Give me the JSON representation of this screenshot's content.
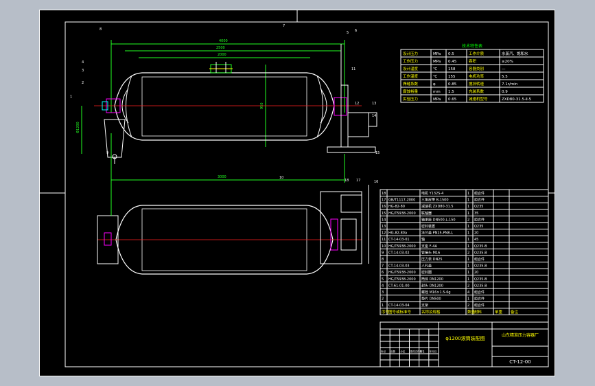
{
  "spec_table": {
    "title": "技术特性表",
    "rows": [
      [
        "设计压力",
        "MPa",
        "0.5",
        "工作介质",
        "水蒸汽、饱和水"
      ],
      [
        "工作压力",
        "MPa",
        "0.45",
        "容积",
        "≥20%"
      ],
      [
        "设计温度",
        "℃",
        "158",
        "容器类别",
        "—"
      ],
      [
        "工作温度",
        "℃",
        "155",
        "电机功率",
        "5.5"
      ],
      [
        "焊缝系数",
        "φ",
        "0.85",
        "搅拌转速",
        "7.1r/min"
      ],
      [
        "腐蚀裕量",
        "mm",
        "1.5",
        "充装系数",
        "0.9"
      ],
      [
        "实验压力",
        "MPa",
        "0.65",
        "减速机型号",
        "ZXD80-31.5-Ⅱ-5"
      ]
    ]
  },
  "parts_list": [
    [
      "18",
      "",
      "电机 Y132S-4",
      "1",
      "组合件",
      "",
      ""
    ],
    [
      "17",
      "GB/T1117-2000",
      "三角皮带 B-1500",
      "1",
      "组合件",
      "",
      ""
    ],
    [
      "16",
      "HG-82-80",
      "减速机 ZXD80-31.5",
      "1",
      "Q235",
      "",
      ""
    ],
    [
      "15",
      "HG/T5938-2000",
      "联轴器",
      "1",
      "35",
      "",
      ""
    ],
    [
      "14",
      "",
      "轴承座 DN500-L-150",
      "2",
      "组合件",
      "",
      ""
    ],
    [
      "13",
      "",
      "密封装置",
      "1",
      "Q235",
      "",
      ""
    ],
    [
      "12",
      "HG-82-80a",
      "法兰盖 PN25-PN8-L",
      "1",
      "20",
      "",
      ""
    ],
    [
      "11",
      "CT-14-03-01",
      "轴",
      "1",
      "45",
      "",
      ""
    ],
    [
      "10",
      "HG/T5938-2000",
      "支座 F-4A",
      "1",
      "Q235-B",
      "",
      ""
    ],
    [
      "9",
      "CT-14-03-02",
      "管接头 M16",
      "2",
      "Q235-B",
      "",
      ""
    ],
    [
      "8",
      "",
      "压力表 DN25",
      "1",
      "组合件",
      "",
      ""
    ],
    [
      "7",
      "CT-14-03-03",
      "人孔盖",
      "1",
      "Q235-B",
      "",
      ""
    ],
    [
      "6",
      "HG/T5938-2000",
      "密封圈",
      "1",
      "20",
      "",
      ""
    ],
    [
      "5",
      "HG/T5938-2000",
      "筒体 DN1200",
      "1",
      "Q235-B",
      "",
      ""
    ],
    [
      "4",
      "CT-61-01-00",
      "封头 DN1200",
      "2",
      "Q235-B",
      "",
      ""
    ],
    [
      "3",
      "",
      "螺栓 M16×1.5-6g",
      "4",
      "组合件",
      "",
      ""
    ],
    [
      "2",
      "",
      "垫片 DN500",
      "1",
      "组合件",
      "",
      ""
    ],
    [
      "1",
      "CT-14-03-04",
      "支架",
      "2",
      "组合件",
      "",
      ""
    ]
  ],
  "parts_header": [
    "序号",
    "图号或标准号",
    "名称及规格",
    "数量",
    "材料",
    "单重",
    "备注"
  ],
  "title_block": {
    "drawing_title": "φ1200滚筒装配图",
    "company": "山东精准压力容器厂",
    "drawing_number": "CT-12-00",
    "rows": [
      "标记",
      "处数",
      "分区",
      "更改文件号",
      "签名",
      "年月日"
    ]
  },
  "dims": {
    "overall_length": "4000",
    "cylinder_length": "2500",
    "shell_length": "2000",
    "support_span": "1000",
    "diameter": "Φ1200",
    "height": "950",
    "bottom_span": "3000"
  },
  "balloons": [
    "8",
    "7",
    "6",
    "5",
    "4",
    "3",
    "2",
    "1",
    "9",
    "10",
    "11",
    "12",
    "13",
    "14",
    "15",
    "16",
    "17",
    "18"
  ]
}
